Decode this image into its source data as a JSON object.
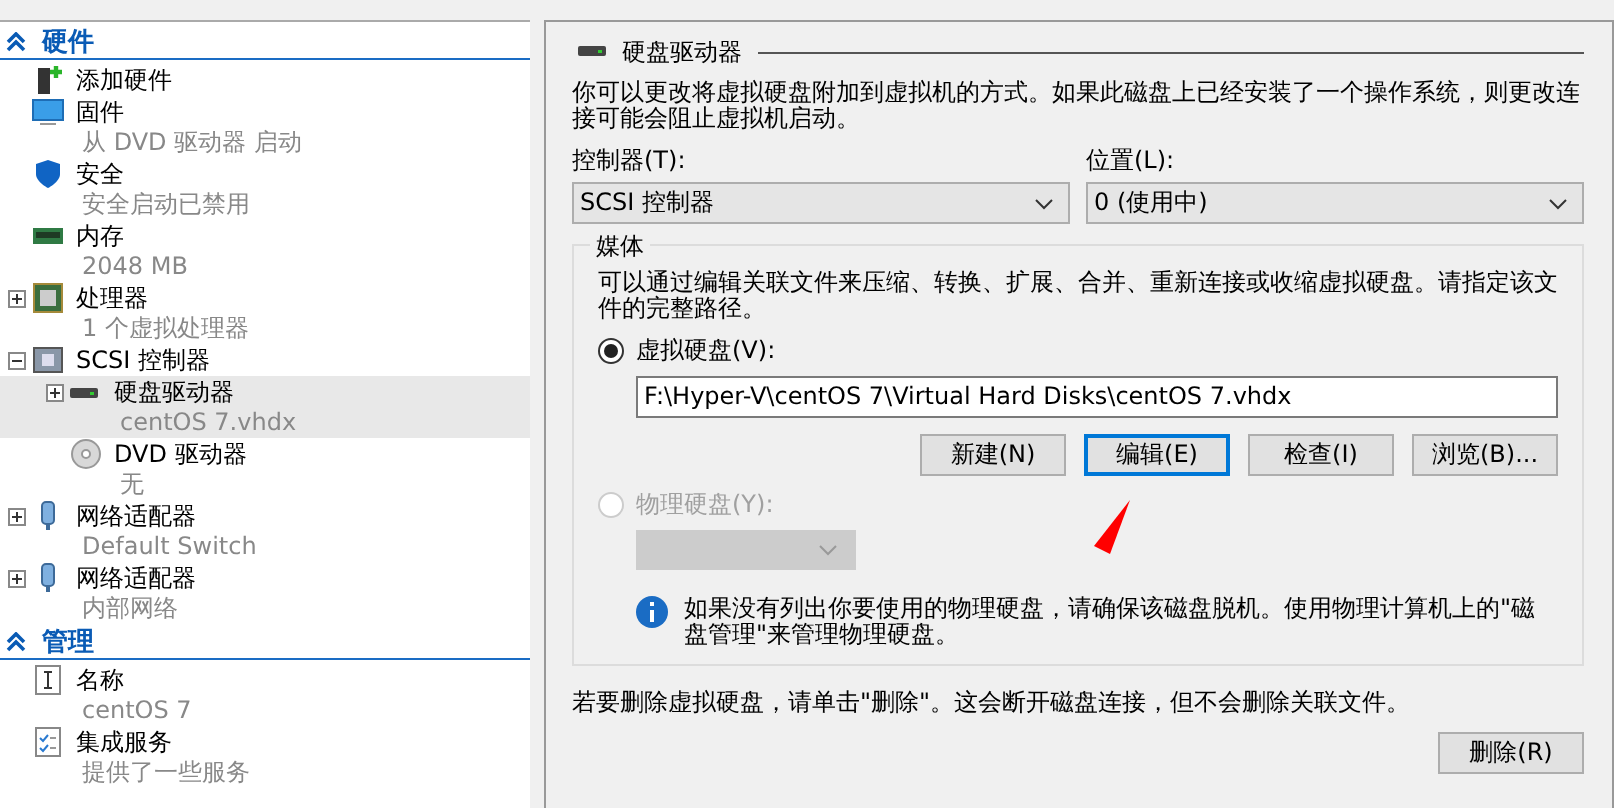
{
  "sidebar": {
    "sections": [
      {
        "title": "硬件",
        "expanded": true,
        "items": [
          {
            "kind": "add",
            "label": "添加硬件",
            "selected": false
          },
          {
            "kind": "firmware",
            "label": "固件",
            "detail": "从 DVD 驱动器 启动",
            "selected": false
          },
          {
            "kind": "security",
            "label": "安全",
            "detail": "安全启动已禁用",
            "selected": false
          },
          {
            "kind": "memory",
            "label": "内存",
            "detail": "2048 MB",
            "selected": false
          },
          {
            "kind": "cpu",
            "label": "处理器",
            "detail": "1 个虚拟处理器",
            "selected": false,
            "expanded": false
          },
          {
            "kind": "controller",
            "label": "SCSI 控制器",
            "selected": false,
            "expanded": true,
            "children": [
              {
                "kind": "disk",
                "label": "硬盘驱动器",
                "detail": "centOS 7.vhdx",
                "selected": true,
                "expanded": false
              },
              {
                "kind": "dvd",
                "label": "DVD 驱动器",
                "detail": "无",
                "selected": false
              }
            ]
          },
          {
            "kind": "network",
            "label": "网络适配器",
            "detail": "Default Switch",
            "selected": false,
            "expanded": false
          },
          {
            "kind": "network",
            "label": "网络适配器",
            "detail": "内部网络",
            "selected": false,
            "expanded": false
          }
        ]
      },
      {
        "title": "管理",
        "expanded": true,
        "items": [
          {
            "kind": "name",
            "label": "名称",
            "detail": "centOS 7",
            "selected": false
          },
          {
            "kind": "services",
            "label": "集成服务",
            "detail": "提供了一些服务",
            "selected": false
          }
        ]
      }
    ]
  },
  "panel": {
    "title": "硬盘驱动器",
    "description": "你可以更改将虚拟硬盘附加到虚拟机的方式。如果此磁盘上已经安装了一个操作系统，则更改连接可能会阻止虚拟机启动。",
    "controller": {
      "label": "控制器(T):",
      "value": "SCSI 控制器"
    },
    "location": {
      "label": "位置(L):",
      "value": "0 (使用中)"
    },
    "media": {
      "title": "媒体",
      "description": "可以通过编辑关联文件来压缩、转换、扩展、合并、重新连接或收缩虚拟硬盘。请指定该文件的完整路径。",
      "virtual_disk": {
        "label": "虚拟硬盘(V):",
        "selected": true,
        "disabled": false,
        "path": "F:\\Hyper-V\\centOS 7\\Virtual Hard Disks\\centOS 7.vhdx"
      },
      "buttons": [
        {
          "label": "新建(N)",
          "focused": false
        },
        {
          "label": "编辑(E)",
          "focused": true
        },
        {
          "label": "检查(I)",
          "focused": false
        },
        {
          "label": "浏览(B)...",
          "focused": false
        }
      ],
      "physical_disk": {
        "label": "物理硬盘(Y):",
        "selected": false,
        "disabled": true
      },
      "info": "如果没有列出你要使用的物理硬盘，请确保该磁盘脱机。使用物理计算机上的\"磁盘管理\"来管理物理硬盘。"
    },
    "remove_note": "若要删除虚拟硬盘，请单击\"删除\"。这会断开磁盘连接，但不会删除关联文件。",
    "remove_button": "删除(R)"
  }
}
